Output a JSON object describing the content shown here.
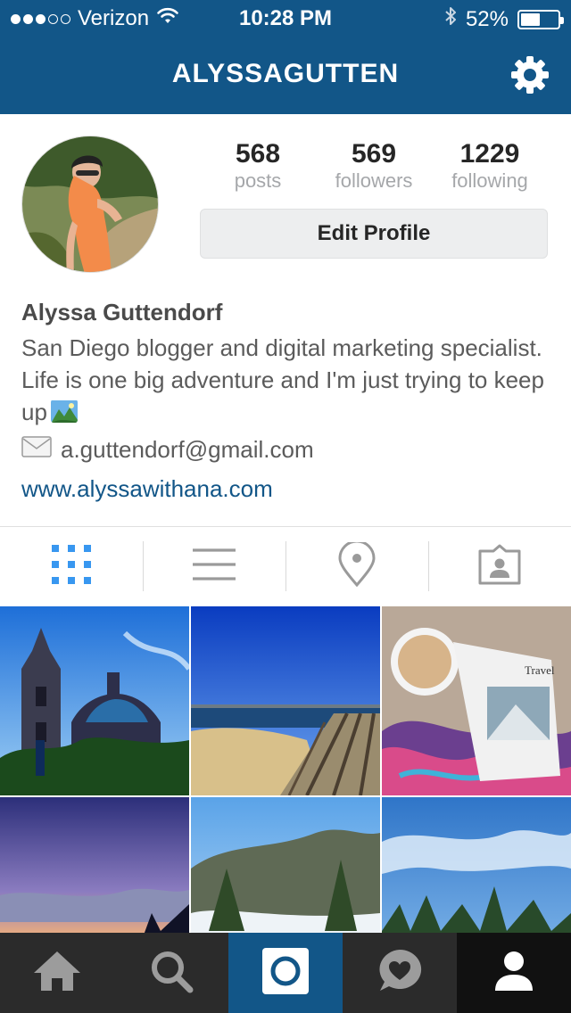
{
  "status_bar": {
    "carrier": "Verizon",
    "time": "10:28 PM",
    "battery_percent": "52%",
    "battery_level": 0.52,
    "signal_bars": 3,
    "icons": [
      "wifi-icon",
      "bluetooth-icon",
      "battery-icon"
    ]
  },
  "nav": {
    "title": "ALYSSAGUTTEN",
    "settings_icon": "gear-icon"
  },
  "profile": {
    "stats": [
      {
        "value": "568",
        "label": "posts"
      },
      {
        "value": "569",
        "label": "followers"
      },
      {
        "value": "1229",
        "label": "following"
      }
    ],
    "edit_button": "Edit Profile",
    "full_name": "Alyssa Guttendorf",
    "bio": "San Diego blogger and digital marketing specialist. Life is one big adventure and I'm just trying to keep up",
    "email": "a.guttendorf@gmail.com",
    "website": "www.alyssawithana.com"
  },
  "tabs": [
    {
      "name": "grid-view",
      "icon": "grid-icon",
      "active": true
    },
    {
      "name": "list-view",
      "icon": "list-icon",
      "active": false
    },
    {
      "name": "map-view",
      "icon": "location-pin-icon",
      "active": false
    },
    {
      "name": "tagged-view",
      "icon": "tagged-person-icon",
      "active": false
    }
  ],
  "bottom_nav": [
    {
      "name": "home",
      "icon": "home-icon"
    },
    {
      "name": "search",
      "icon": "search-icon"
    },
    {
      "name": "camera",
      "icon": "camera-icon"
    },
    {
      "name": "activity",
      "icon": "heart-bubble-icon"
    },
    {
      "name": "profile",
      "icon": "person-icon"
    }
  ],
  "colors": {
    "brand": "#125688",
    "tab_active": "#3897f0",
    "tab_inactive": "#999999",
    "link": "#125688"
  }
}
